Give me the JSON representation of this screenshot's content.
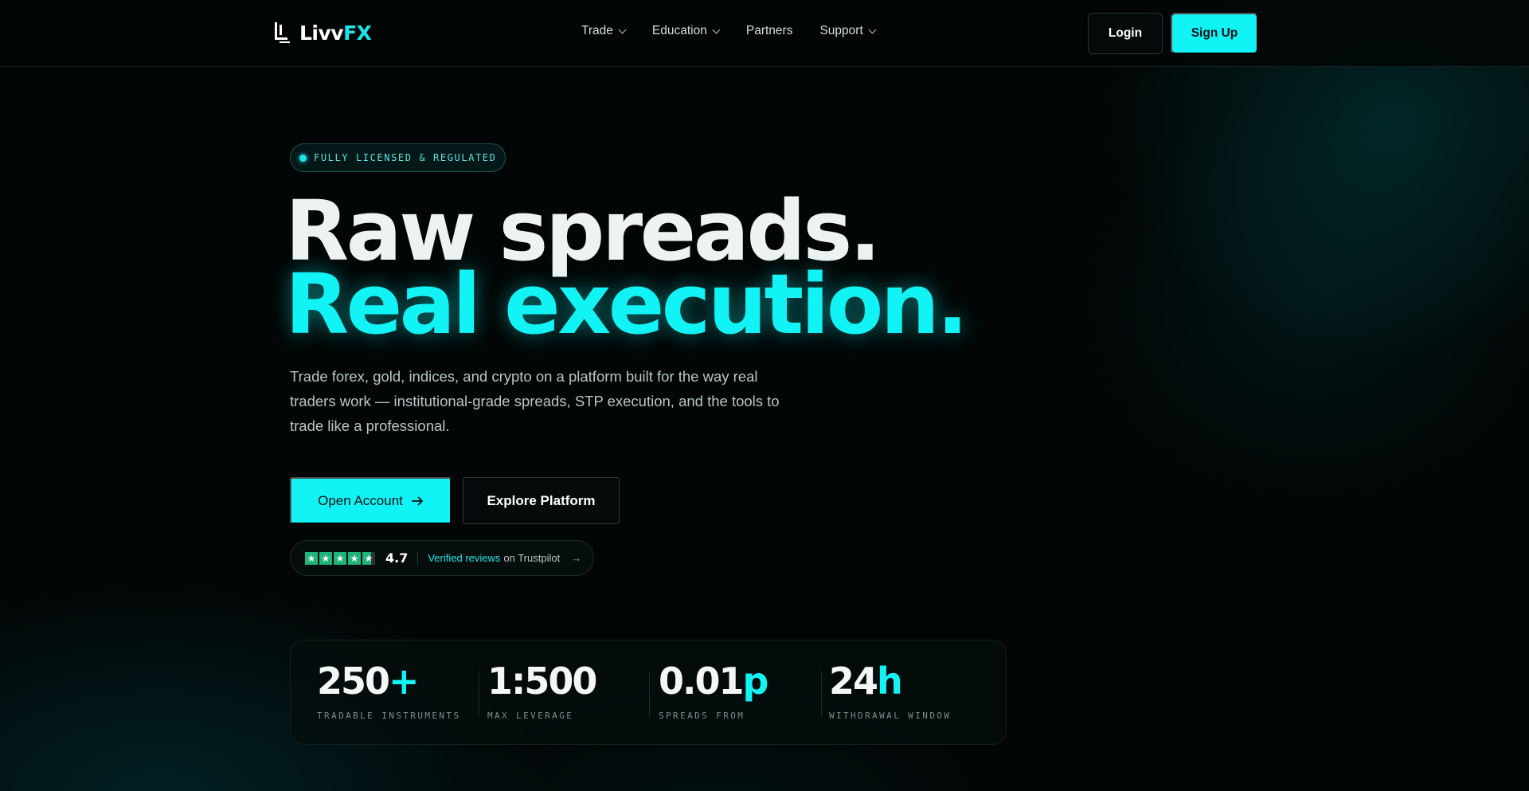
{
  "brand": {
    "name_main": "Livv",
    "name_accent": "FX",
    "accent_color": "#12f3f5"
  },
  "nav": {
    "items": [
      {
        "label": "Trade",
        "has_dropdown": true
      },
      {
        "label": "Education",
        "has_dropdown": true
      },
      {
        "label": "Partners",
        "has_dropdown": false
      },
      {
        "label": "Support",
        "has_dropdown": true
      }
    ],
    "login_label": "Login",
    "signup_label": "Sign Up"
  },
  "hero": {
    "badge": "FULLY LICENSED & REGULATED",
    "headline_line1": "Raw spreads.",
    "headline_line2": "Real execution.",
    "lede": "Trade forex, gold, indices, and crypto on a platform built for the way real traders work — institutional-grade spreads, STP execution, and the tools to trade like a professional.",
    "primary_cta": "Open Account",
    "primary_cta_icon": "arrow-right-icon",
    "secondary_cta": "Explore Platform"
  },
  "trustpilot": {
    "stars": 5,
    "rating": "4.7",
    "verified_label": "Verified reviews",
    "suffix": "on Trustpilot",
    "arrow": "→",
    "star_color": "#1fb47a"
  },
  "stats": [
    {
      "value": "250",
      "accent": "+",
      "label": "TRADABLE INSTRUMENTS"
    },
    {
      "value": "1:500",
      "accent": "",
      "label": "MAX LEVERAGE"
    },
    {
      "value": "0.01",
      "accent": "p",
      "label": "SPREADS FROM"
    },
    {
      "value": "24",
      "accent": "h",
      "label": "WITHDRAWAL WINDOW"
    }
  ]
}
